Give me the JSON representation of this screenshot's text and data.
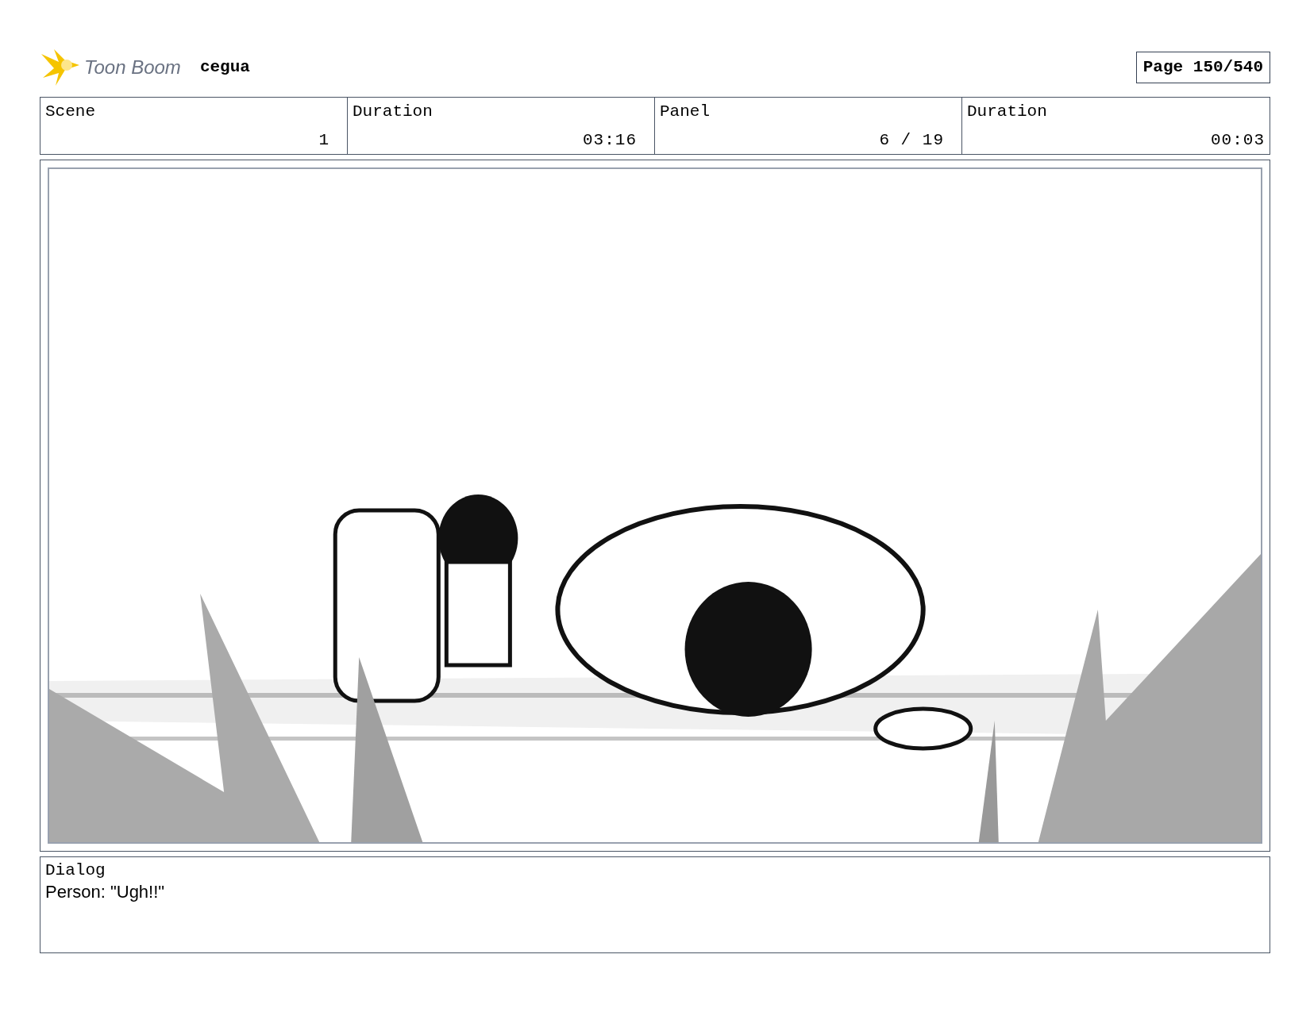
{
  "header": {
    "logo_text": "Toon Boom",
    "project": "cegua",
    "page": "Page 150/540"
  },
  "fields": [
    {
      "label": "Scene",
      "value": "1"
    },
    {
      "label": "Duration",
      "value": "03:16"
    },
    {
      "label": "Panel",
      "value": "6 / 19"
    },
    {
      "label": "Duration",
      "value": "00:03"
    }
  ],
  "dialog": {
    "label": "Dialog",
    "text": "Person: \"Ugh!!\""
  }
}
